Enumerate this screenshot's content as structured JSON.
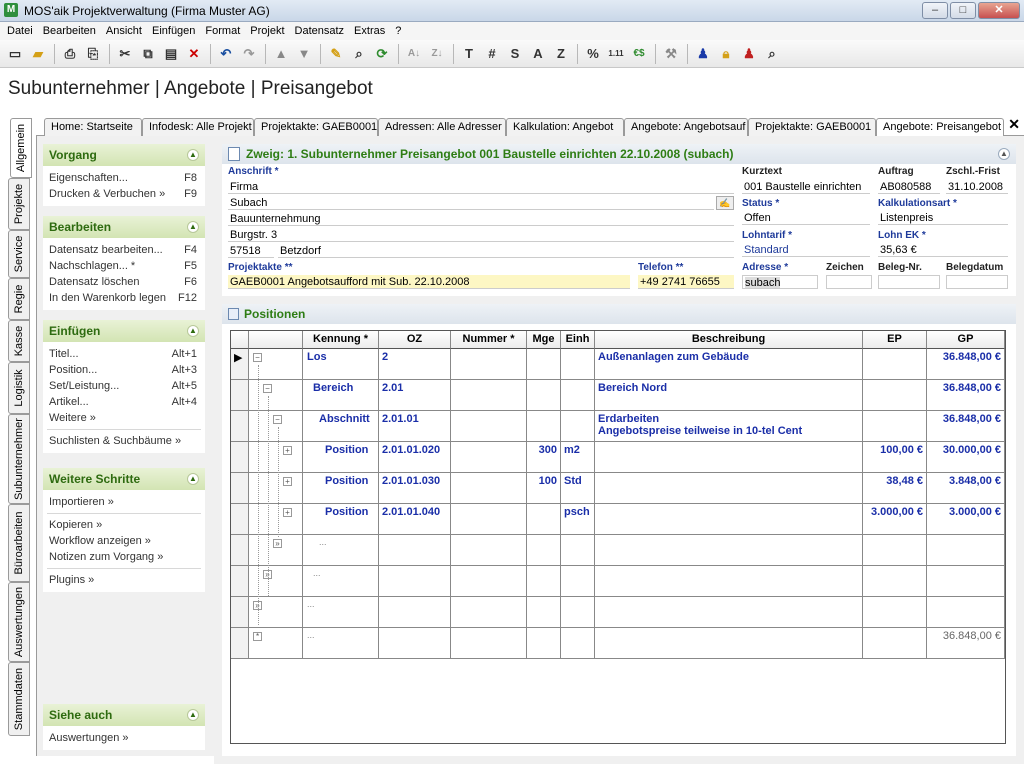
{
  "window": {
    "title": "MOS'aik Projektverwaltung (Firma Muster AG)",
    "app_icon": "M"
  },
  "menu": [
    "Datei",
    "Bearbeiten",
    "Ansicht",
    "Einfügen",
    "Format",
    "Projekt",
    "Datensatz",
    "Extras",
    "?"
  ],
  "toolbar": {
    "buttons": [
      "new-icon",
      "open-icon",
      "print-icon",
      "print-preview-icon",
      "cut-icon",
      "copy-icon",
      "paste-icon",
      "delete-icon",
      "undo-icon",
      "redo-icon",
      "move-up-icon",
      "move-down-icon",
      "edit-icon",
      "search-icon",
      "refresh-icon",
      "sort-asc-icon",
      "sort-desc-icon",
      "T",
      "#",
      "S",
      "A",
      "Z",
      "%",
      "1.11",
      "€$",
      "tools-icon",
      "user-blue-icon",
      "lock-icon",
      "user-red-icon",
      "preview-icon"
    ]
  },
  "page_title": "Subunternehmer | Angebote | Preisangebot",
  "tabs": [
    "Home: Startseite",
    "Infodesk: Alle Projekt",
    "Projektakte: GAEB0001",
    "Adressen: Alle Adresser",
    "Kalkulation: Angebot",
    "Angebote: Angebotsauf",
    "Projektakte: GAEB0001",
    "Angebote: Preisangebot"
  ],
  "vtabs": [
    "Allgemein",
    "Projekte",
    "Service",
    "Regie",
    "Kasse",
    "Logistik",
    "Subunternehmer",
    "Büroarbeiten",
    "Auswertungen",
    "Stammdaten"
  ],
  "sidebar": {
    "vorgang": {
      "title": "Vorgang",
      "items": [
        {
          "label": "Eigenschaften...",
          "key": "F8"
        },
        {
          "label": "Drucken & Verbuchen »",
          "key": "F9"
        }
      ]
    },
    "bearbeiten": {
      "title": "Bearbeiten",
      "items": [
        {
          "label": "Datensatz bearbeiten...",
          "key": "F4"
        },
        {
          "label": "Nachschlagen... *",
          "key": "F5"
        },
        {
          "label": "Datensatz löschen",
          "key": "F6"
        },
        {
          "label": "In den Warenkorb legen",
          "key": "F12"
        }
      ]
    },
    "einfuegen": {
      "title": "Einfügen",
      "items": [
        {
          "label": "Titel...",
          "key": "Alt+1"
        },
        {
          "label": "Position...",
          "key": "Alt+3"
        },
        {
          "label": "Set/Leistung...",
          "key": "Alt+5"
        },
        {
          "label": "Artikel...",
          "key": "Alt+4"
        },
        {
          "label": "Weitere »",
          "key": ""
        }
      ],
      "extra": "Suchlisten & Suchbäume »"
    },
    "weitere": {
      "title": "Weitere Schritte",
      "items": [
        "Importieren »",
        "Kopieren »",
        "Workflow anzeigen »",
        "Notizen zum Vorgang »",
        "Plugins »"
      ]
    },
    "siehe": {
      "title": "Siehe auch",
      "items": [
        "Auswertungen »"
      ]
    }
  },
  "zweig": {
    "title": "Zweig: 1. Subunternehmer Preisangebot 001 Baustelle einrichten 22.10.2008 (subach)"
  },
  "form": {
    "anschrift_label": "Anschrift *",
    "anschrift": [
      "Firma",
      "Subach",
      "Bauunternehmung",
      "Burgstr. 3"
    ],
    "plz": "57518",
    "ort": "Betzdorf",
    "projektakte_label": "Projektakte **",
    "projektakte": "GAEB0001 Angebotsaufford mit Sub. 22.10.2008",
    "telefon_label": "Telefon **",
    "telefon": "+49 2741 76655",
    "kurztext_label": "Kurztext",
    "kurztext": "001 Baustelle einrichten",
    "auftrag_label": "Auftrag",
    "auftrag": "AB080588",
    "zschl_label": "Zschl.-Frist",
    "zschl": "31.10.2008",
    "status_label": "Status *",
    "status": "Offen",
    "kalk_label": "Kalkulationsart *",
    "kalk": "Listenpreis",
    "lohntarif_label": "Lohntarif *",
    "lohntarif": "Standard",
    "lohnek_label": "Lohn EK *",
    "lohnek": "35,63 €",
    "adresse_label": "Adresse *",
    "adresse": "subach",
    "zeichen_label": "Zeichen",
    "zeichen": "",
    "belegnr_label": "Beleg-Nr.",
    "belegnr": "",
    "belegdatum_label": "Belegdatum",
    "belegdatum": ""
  },
  "positionen": {
    "title": "Positionen",
    "columns": [
      "Kennung *",
      "OZ",
      "Nummer *",
      "Mge",
      "Einh",
      "Beschreibung",
      "EP",
      "GP"
    ],
    "rows": [
      {
        "kennung": "Los",
        "oz": "2",
        "nummer": "",
        "mge": "",
        "einh": "",
        "beschr": "Außenanlagen zum Gebäude",
        "beschr2": "",
        "ep": "",
        "gp": "36.848,00 €"
      },
      {
        "kennung": "Bereich",
        "oz": "2.01",
        "nummer": "",
        "mge": "",
        "einh": "",
        "beschr": "Bereich Nord",
        "beschr2": "",
        "ep": "",
        "gp": "36.848,00 €"
      },
      {
        "kennung": "Abschnitt",
        "oz": "2.01.01",
        "nummer": "",
        "mge": "",
        "einh": "",
        "beschr": "Erdarbeiten",
        "beschr2": "Angebotspreise teilweise in 10-tel Cent",
        "ep": "",
        "gp": "36.848,00 €"
      },
      {
        "kennung": "Position",
        "oz": "2.01.01.020",
        "nummer": "",
        "mge": "300",
        "einh": "m2",
        "beschr": "",
        "beschr2": "",
        "ep": "100,00 €",
        "gp": "30.000,00 €"
      },
      {
        "kennung": "Position",
        "oz": "2.01.01.030",
        "nummer": "",
        "mge": "100",
        "einh": "Std",
        "beschr": "",
        "beschr2": "",
        "ep": "38,48 €",
        "gp": "3.848,00 €"
      },
      {
        "kennung": "Position",
        "oz": "2.01.01.040",
        "nummer": "",
        "mge": "",
        "einh": "psch",
        "beschr": "",
        "beschr2": "",
        "ep": "3.000,00 €",
        "gp": "3.000,00 €"
      },
      {
        "kennung": "...",
        "oz": "",
        "nummer": "",
        "mge": "",
        "einh": "",
        "beschr": "",
        "beschr2": "",
        "ep": "",
        "gp": ""
      },
      {
        "kennung": "...",
        "oz": "",
        "nummer": "",
        "mge": "",
        "einh": "",
        "beschr": "",
        "beschr2": "",
        "ep": "",
        "gp": ""
      },
      {
        "kennung": "...",
        "oz": "",
        "nummer": "",
        "mge": "",
        "einh": "",
        "beschr": "",
        "beschr2": "",
        "ep": "",
        "gp": ""
      },
      {
        "kennung": "...",
        "oz": "",
        "nummer": "",
        "mge": "",
        "einh": "",
        "beschr": "",
        "beschr2": "",
        "ep": "",
        "gp": "36.848,00 €"
      }
    ]
  }
}
